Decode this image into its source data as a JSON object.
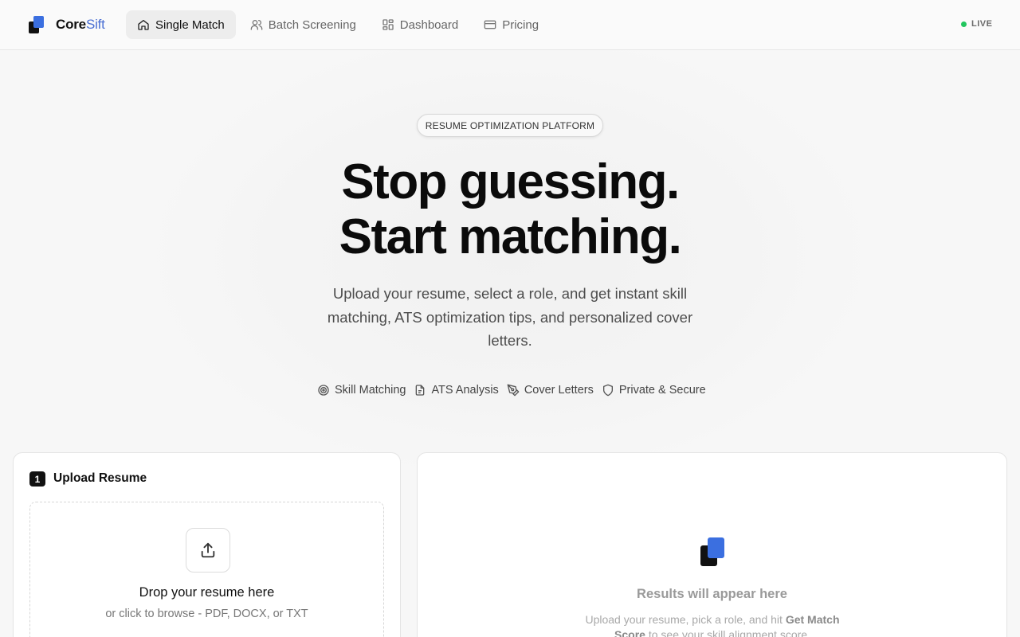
{
  "brand": {
    "name_bold": "Core",
    "name_light": "Sift",
    "logo_colors": [
      "#111111",
      "#3b6fe0"
    ]
  },
  "nav": {
    "items": [
      {
        "label": "Single Match",
        "icon": "home-icon",
        "active": true
      },
      {
        "label": "Batch Screening",
        "icon": "users-icon",
        "active": false
      },
      {
        "label": "Dashboard",
        "icon": "grid-icon",
        "active": false
      },
      {
        "label": "Pricing",
        "icon": "credit-card-icon",
        "active": false
      }
    ]
  },
  "status": {
    "label": "LIVE",
    "color": "#22c55e"
  },
  "hero": {
    "badge": "RESUME OPTIMIZATION PLATFORM",
    "headline_1": "Stop guessing.",
    "headline_2": "Start matching.",
    "subtitle": "Upload your resume, select a role, and get instant skill matching, ATS optimization tips, and personalized cover letters.",
    "features": [
      {
        "label": "Skill Matching",
        "icon": "target-icon"
      },
      {
        "label": "ATS Analysis",
        "icon": "document-scan-icon"
      },
      {
        "label": "Cover Letters",
        "icon": "pen-icon"
      },
      {
        "label": "Private & Secure",
        "icon": "shield-icon"
      }
    ]
  },
  "upload": {
    "step": "1",
    "title": "Upload Resume",
    "drop_title": "Drop your resume here",
    "drop_sub": "or click to browse - PDF, DOCX, or TXT"
  },
  "results": {
    "title": "Results will appear here",
    "sub_1": "Upload your resume, pick a role, and hit ",
    "sub_bold": "Get Match Score",
    "sub_2": " to see your skill alignment score."
  }
}
